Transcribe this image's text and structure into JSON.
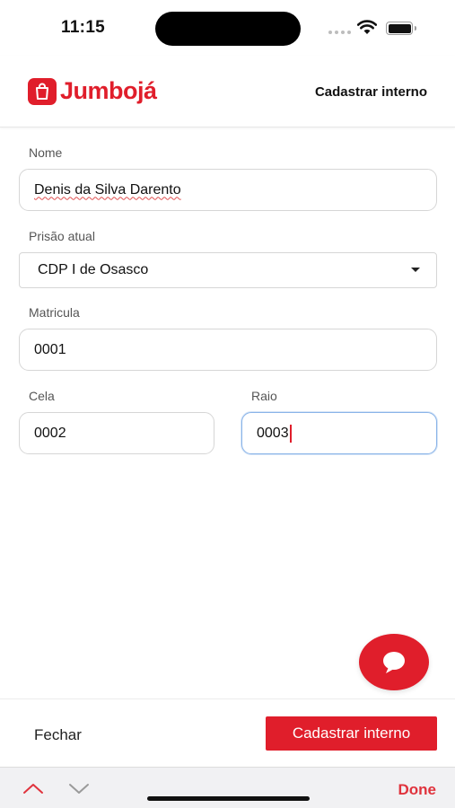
{
  "status_bar": {
    "time": "11:15"
  },
  "header": {
    "brand_name": "Jumbojá",
    "action_label": "Cadastrar interno"
  },
  "form": {
    "nome": {
      "label": "Nome",
      "value": "Denis da Silva Darento"
    },
    "prisao_atual": {
      "label": "Prisão atual",
      "selected": "CDP I de Osasco"
    },
    "matricula": {
      "label": "Matricula",
      "value": "0001"
    },
    "cela": {
      "label": "Cela",
      "value": "0002"
    },
    "raio": {
      "label": "Raio",
      "value": "0003"
    }
  },
  "footer": {
    "close_label": "Fechar",
    "submit_label": "Cadastrar interno"
  },
  "keyboard_accessory": {
    "done_label": "Done"
  },
  "colors": {
    "brand": "#e01e2b",
    "focus_border": "#8ab4e8"
  }
}
